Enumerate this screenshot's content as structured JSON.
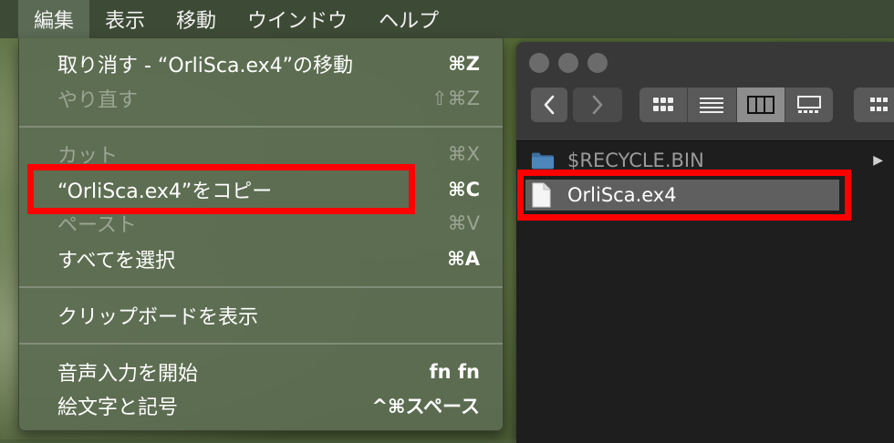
{
  "menubar": {
    "items": [
      {
        "label": "編集",
        "active": true
      },
      {
        "label": "表示"
      },
      {
        "label": "移動"
      },
      {
        "label": "ウインドウ"
      },
      {
        "label": "ヘルプ"
      }
    ]
  },
  "edit_menu": {
    "items": [
      {
        "label": "取り消す - “OrliSca.ex4”の移動",
        "shortcut": "⌘Z",
        "enabled": true
      },
      {
        "label": "やり直す",
        "shortcut": "⇧⌘Z",
        "enabled": false
      },
      {
        "label": "カット",
        "shortcut": "⌘X",
        "enabled": false
      },
      {
        "label": "“OrliSca.ex4”をコピー",
        "shortcut": "⌘C",
        "enabled": true,
        "highlighted_annotation": true
      },
      {
        "label": "ペースト",
        "shortcut": "⌘V",
        "enabled": false
      },
      {
        "label": "すべてを選択",
        "shortcut": "⌘A",
        "enabled": true
      },
      {
        "label": "クリップボードを表示",
        "shortcut": "",
        "enabled": true
      },
      {
        "label": "音声入力を開始",
        "shortcut": "fn fn",
        "enabled": true
      },
      {
        "label": "絵文字と記号",
        "shortcut": "^⌘スペース",
        "enabled": true
      }
    ]
  },
  "finder": {
    "view_modes": [
      "icon-view",
      "list-view",
      "column-view",
      "gallery-view"
    ],
    "selected_view": "column-view",
    "column_items": [
      {
        "name": "$RECYCLE.BIN",
        "kind": "folder",
        "dimmed": true
      },
      {
        "name": "OrliSca.ex4",
        "kind": "file",
        "selected": true
      }
    ]
  },
  "colors": {
    "annotation_red": "#ff0000",
    "menubar_bg": "#3d4a35",
    "menu_bg": "#5c6c52",
    "finder_bg": "#1e1e1e"
  }
}
